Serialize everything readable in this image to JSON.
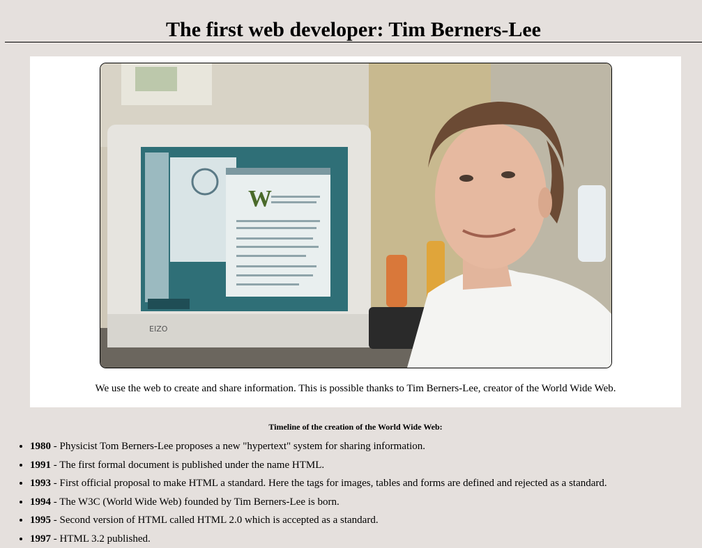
{
  "page": {
    "title": "The first web developer: Tim Berners-Lee"
  },
  "figure": {
    "image_alt": "Photo of Tim Berners-Lee sitting beside a computer showing the World Wide Web",
    "caption": "We use the web to create and share information. This is possible thanks to Tim Berners-Lee, creator of the World Wide Web."
  },
  "timeline": {
    "heading": "Timeline of the creation of the World Wide Web:",
    "items": [
      {
        "year": "1980",
        "text": " - Physicist Tom Berners-Lee proposes a new \"hypertext\" system for sharing information."
      },
      {
        "year": "1991",
        "text": " - The first formal document is published under the name HTML."
      },
      {
        "year": "1993",
        "text": " - First official proposal to make HTML a standard. Here the tags for images, tables and forms are defined and rejected as a standard."
      },
      {
        "year": "1994",
        "text": " - The W3C (World Wide Web) founded by Tim Berners-Lee is born."
      },
      {
        "year": "1995",
        "text": " - Second version of HTML called HTML 2.0 which is accepted as a standard."
      },
      {
        "year": "1997",
        "text": " - HTML 3.2 published."
      }
    ]
  },
  "colors": {
    "background": "#e5e0dd",
    "card": "#ffffff",
    "text": "#000000"
  }
}
